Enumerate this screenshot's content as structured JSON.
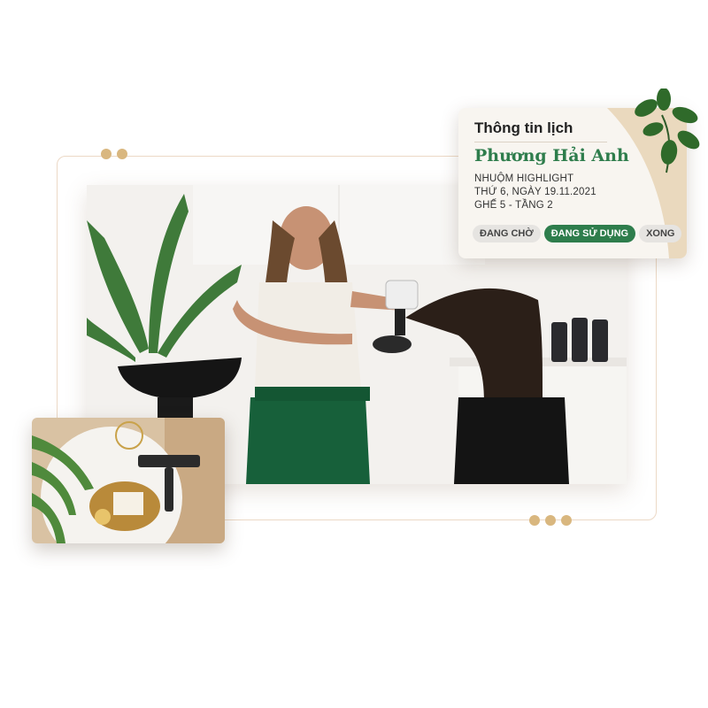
{
  "card": {
    "title": "Thông tin lịch",
    "customer_name": "Phương Hải Anh",
    "service": "NHUỘM HIGHLIGHT",
    "date": "THỨ 6, NGÀY 19.11.2021",
    "seat": "GHẾ 5 - TẦNG 2",
    "statuses": [
      {
        "label": "ĐANG CHỜ",
        "active": false
      },
      {
        "label": "ĐANG SỬ DỤNG",
        "active": true
      },
      {
        "label": "XONG",
        "active": false
      }
    ]
  },
  "colors": {
    "accent_green": "#2e7d4c",
    "dot_gold": "#d9b77f",
    "frame_border": "#ecd9c6"
  },
  "images": {
    "main_photo": "salon-hair-styling-photo",
    "small_photo": "hair-dryer-product-photo"
  }
}
